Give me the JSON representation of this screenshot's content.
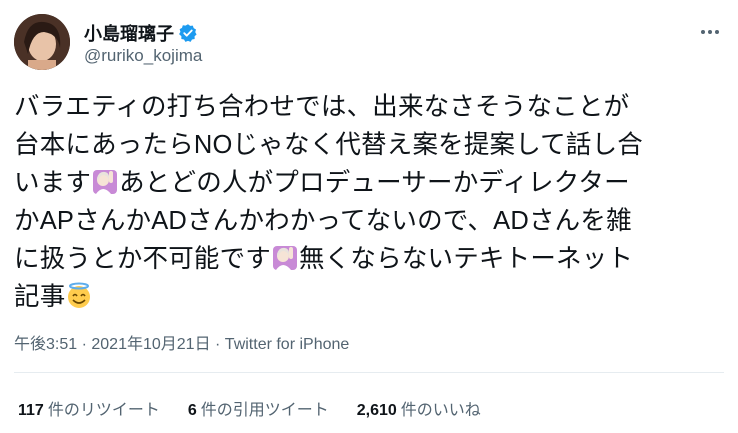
{
  "user": {
    "display_name": "小島瑠璃子",
    "handle": "@ruriko_kojima"
  },
  "tweet": {
    "lines": [
      "バラエティの打ち合わせでは、出来なさそうなことが",
      "台本にあったらNOじゃなく代替え案を提案して話し合",
      "います",
      "あとどの人がプロデューサーかディレクター",
      "かAPさんかADさんかわかってないので、ADさんを雑",
      "に扱うとか不可能です",
      "無くならないテキトーネット",
      "記事"
    ]
  },
  "meta": {
    "time": "午後3:51",
    "sep1": " · ",
    "date": "2021年10月21日",
    "sep2": " · ",
    "source": "Twitter for iPhone"
  },
  "stats": {
    "retweets_num": "117",
    "retweets_label": "件のリツイート",
    "quotes_num": "6",
    "quotes_label": "件の引用ツイート",
    "likes_num": "2,610",
    "likes_label": "件のいいね"
  },
  "icons": {
    "verified": "verified-badge-icon",
    "more": "more-dots-icon",
    "emoji1": "person-raising-hand-emoji",
    "emoji2": "halo-smiling-face-emoji"
  },
  "colors": {
    "text": "#0f1419",
    "secondary": "#536471",
    "verified_blue": "#1d9bf0",
    "divider": "#e6ecf0"
  }
}
